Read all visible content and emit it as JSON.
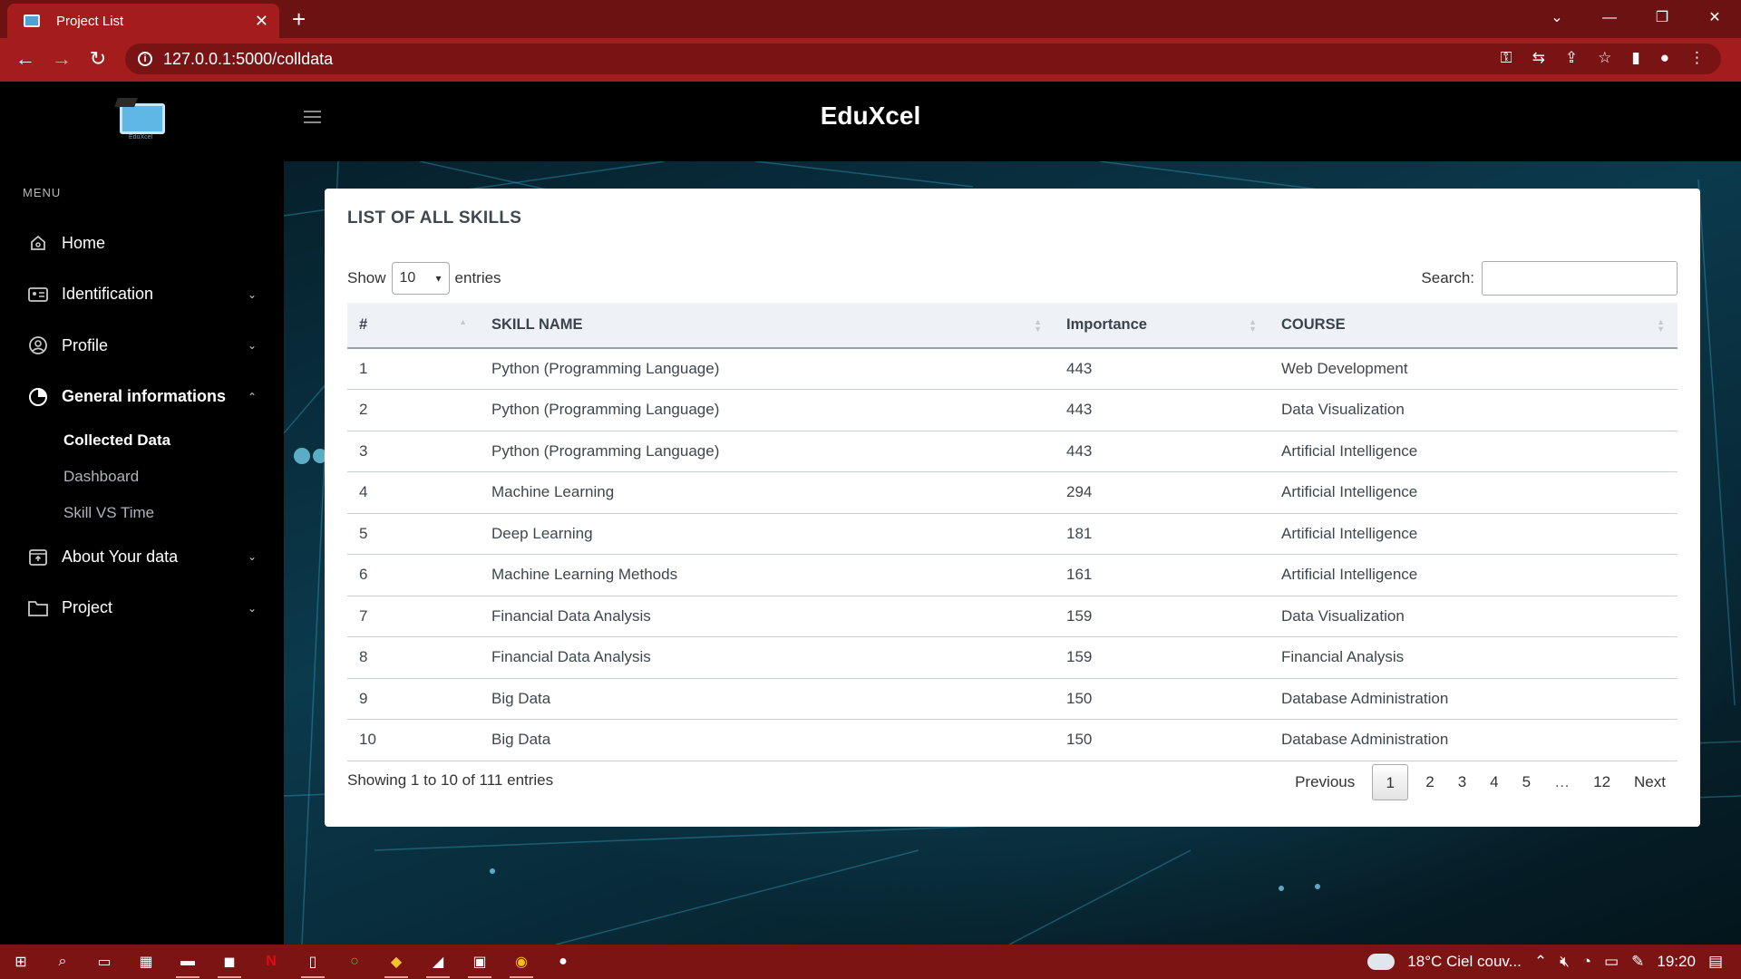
{
  "browser": {
    "tab_title": "Project List",
    "tab_close": "✕",
    "new_tab": "+",
    "url": "127.0.0.1:5000/colldata",
    "win_minimize": "—",
    "win_restore": "❐",
    "win_close": "✕",
    "win_menu": "⌄"
  },
  "app": {
    "brand": "EduXcel",
    "logo_text": "EduXcel"
  },
  "sidebar": {
    "menu_label": "MENU",
    "items": [
      {
        "label": "Home",
        "icon": "home-icon",
        "chevron": ""
      },
      {
        "label": "Identification",
        "icon": "id-card-icon",
        "chevron": "⌄"
      },
      {
        "label": "Profile",
        "icon": "user-circle-icon",
        "chevron": "⌄"
      },
      {
        "label": "General informations",
        "icon": "pie-chart-icon",
        "chevron": "⌃"
      },
      {
        "label": "About Your data",
        "icon": "archive-icon",
        "chevron": "⌄"
      },
      {
        "label": "Project",
        "icon": "folder-icon",
        "chevron": "⌄"
      }
    ],
    "subitems": [
      {
        "label": "Collected Data",
        "current": true
      },
      {
        "label": "Dashboard",
        "current": false
      },
      {
        "label": "Skill VS Time",
        "current": false
      }
    ]
  },
  "card": {
    "title": "LIST OF ALL SKILLS",
    "show_label": "Show",
    "page_length": "10",
    "entries_label": "entries",
    "search_label": "Search:",
    "search_value": ""
  },
  "table": {
    "headers": [
      "#",
      "SKILL NAME",
      "Importance",
      "COURSE"
    ],
    "rows": [
      [
        "1",
        "Python (Programming Language)",
        "443",
        "Web Development"
      ],
      [
        "2",
        "Python (Programming Language)",
        "443",
        "Data Visualization"
      ],
      [
        "3",
        "Python (Programming Language)",
        "443",
        "Artificial Intelligence"
      ],
      [
        "4",
        "Machine Learning",
        "294",
        "Artificial Intelligence"
      ],
      [
        "5",
        "Deep Learning",
        "181",
        "Artificial Intelligence"
      ],
      [
        "6",
        "Machine Learning Methods",
        "161",
        "Artificial Intelligence"
      ],
      [
        "7",
        "Financial Data Analysis",
        "159",
        "Data Visualization"
      ],
      [
        "8",
        "Financial Data Analysis",
        "159",
        "Financial Analysis"
      ],
      [
        "9",
        "Big Data",
        "150",
        "Database Administration"
      ],
      [
        "10",
        "Big Data",
        "150",
        "Database Administration"
      ]
    ]
  },
  "footer": {
    "info": "Showing 1 to 10 of 111 entries",
    "previous": "Previous",
    "pages": [
      "1",
      "2",
      "3",
      "4",
      "5",
      "…",
      "12"
    ],
    "next": "Next",
    "current_page": "1"
  },
  "taskbar": {
    "weather": "18°C  Ciel couv...",
    "time": "19:20"
  },
  "colors": {
    "browser_dark": "#6d1212",
    "browser_accent": "#a51c1c",
    "sidebar_bg": "#000000",
    "card_bg": "#ffffff",
    "table_header_bg": "#eef1f5"
  }
}
